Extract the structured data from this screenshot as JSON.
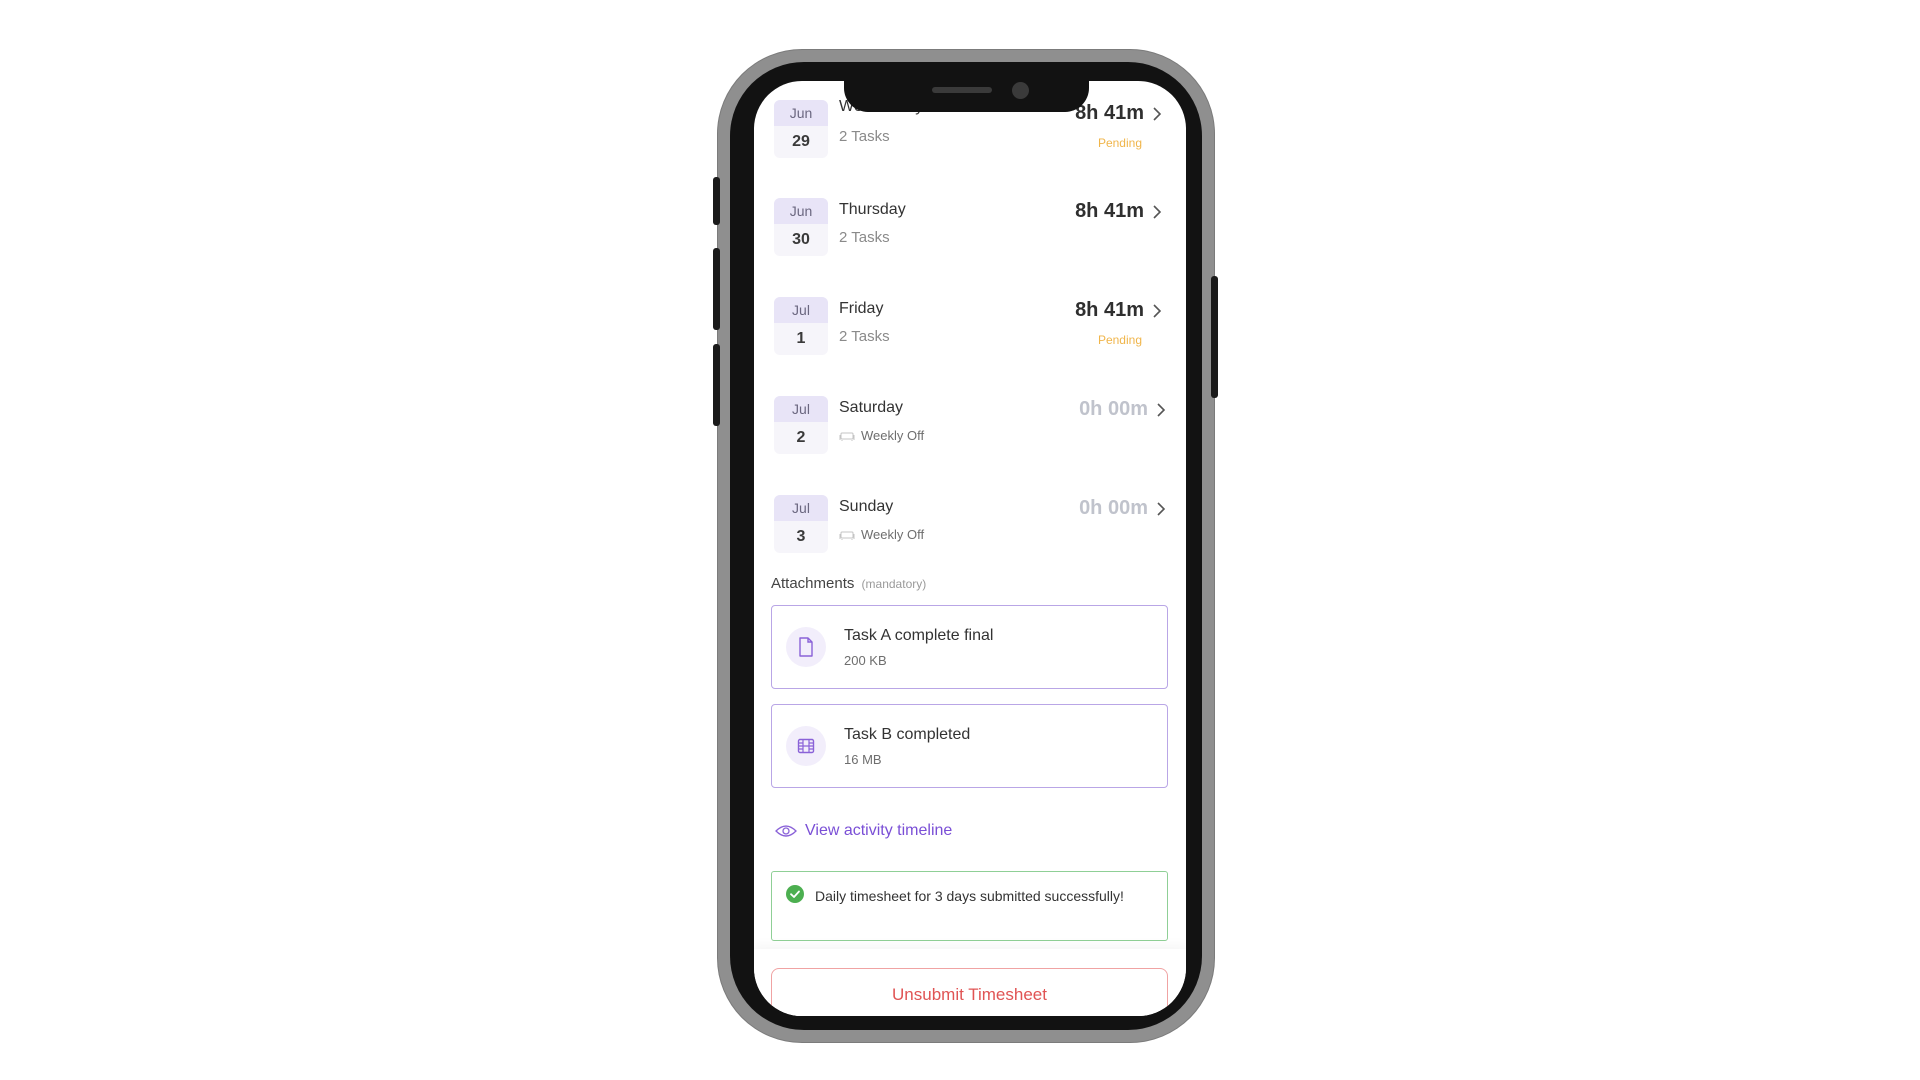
{
  "days": [
    {
      "month": "Jun",
      "day": "29",
      "name": "Wednesday",
      "sub": "2 Tasks",
      "hours": "8h 41m",
      "status": "Pending",
      "off": false
    },
    {
      "month": "Jun",
      "day": "30",
      "name": "Thursday",
      "sub": "2 Tasks",
      "hours": "8h 41m",
      "status": "",
      "off": false
    },
    {
      "month": "Jul",
      "day": "1",
      "name": "Friday",
      "sub": "2 Tasks",
      "hours": "8h 41m",
      "status": "Pending",
      "off": false
    },
    {
      "month": "Jul",
      "day": "2",
      "name": "Saturday",
      "sub": "Weekly Off",
      "hours": "0h 00m",
      "status": "",
      "off": true
    },
    {
      "month": "Jul",
      "day": "3",
      "name": "Sunday",
      "sub": "Weekly Off",
      "hours": "0h 00m",
      "status": "",
      "off": true
    }
  ],
  "attachments": {
    "title": "Attachments",
    "mandatory": "(mandatory)",
    "files": [
      {
        "name": "Task A complete final",
        "size": "200 KB",
        "icon": "document-icon"
      },
      {
        "name": "Task B completed",
        "size": "16 MB",
        "icon": "film-icon"
      }
    ]
  },
  "timeline": {
    "label": "View activity timeline",
    "icon": "eye-icon"
  },
  "banner": {
    "text": "Daily timesheet for 3 days submitted successfully!",
    "icon": "check-circle-icon"
  },
  "actions": {
    "unsubmit_label": "Unsubmit Timesheet"
  },
  "colors": {
    "accent": "#7a4fd6",
    "pending": "#f0b54a",
    "success": "#4caf50",
    "danger": "#e05454",
    "date_chip_header": "#e8e4f7"
  }
}
